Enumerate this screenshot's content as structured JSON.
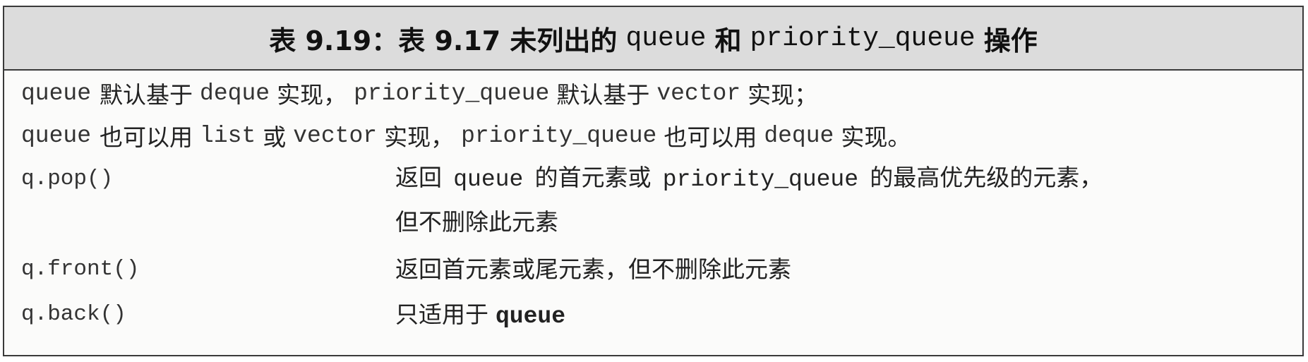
{
  "table": {
    "title": {
      "prefix": "表 9.19：表 9.17 未列出的",
      "code1": "queue",
      "mid": "和",
      "code2": "priority_queue",
      "suffix": "操作"
    },
    "notes": [
      {
        "a": "queue",
        "b": "默认基于",
        "c": "deque",
        "d": "实现，",
        "e": "priority_queue",
        "f": "默认基于",
        "g": "vector",
        "h": "实现；"
      },
      {
        "a": "queue",
        "b": "也可以用",
        "c": "list",
        "d": "或",
        "e": "vector",
        "f": "实现，",
        "g": "priority_queue",
        "h": "也可以用",
        "i": "deque",
        "j": "实现。"
      }
    ],
    "operations": [
      {
        "name": "q.pop()",
        "desc_line1_a": "返回",
        "desc_line1_b": "queue",
        "desc_line1_c": "的首元素或",
        "desc_line1_d": "priority_queue",
        "desc_line1_e": "的最高优先级的元素，",
        "desc_line2": "但不删除此元素"
      },
      {
        "name": "q.front()",
        "desc": "返回首元素或尾元素，但不删除此元素"
      },
      {
        "name": "q.back()",
        "desc_a": "只适用于",
        "desc_b": "queue"
      }
    ]
  }
}
